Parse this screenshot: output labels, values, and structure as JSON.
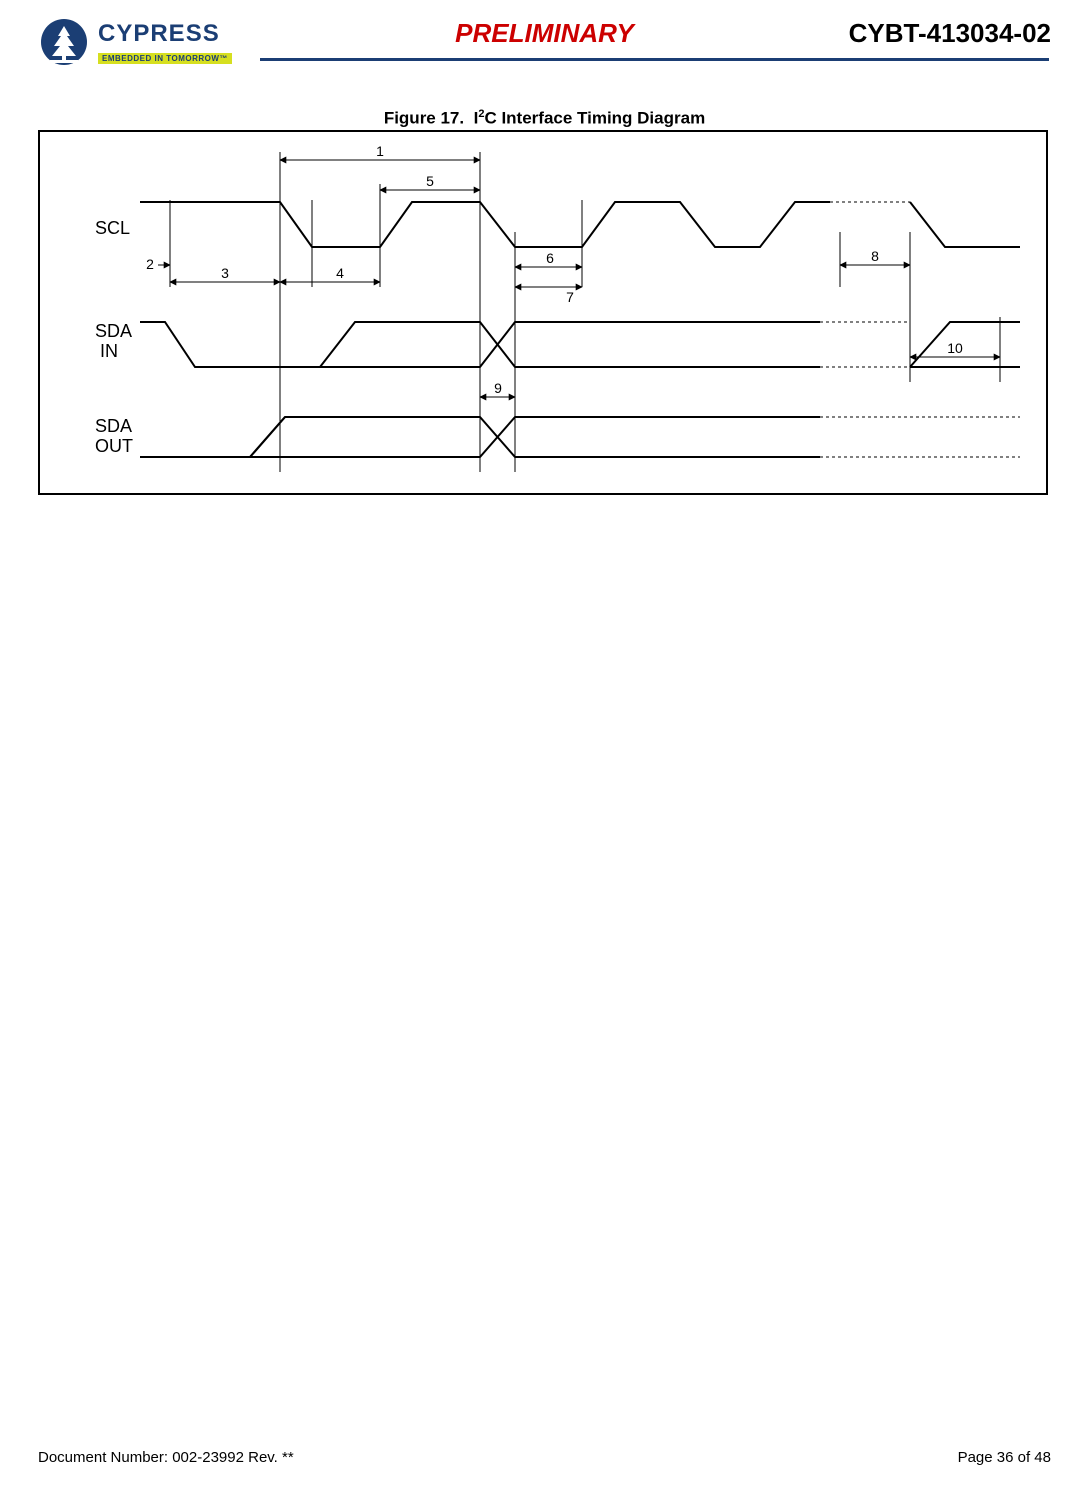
{
  "header": {
    "logo_main": "CYPRESS",
    "logo_sub": "EMBEDDED IN TOMORROW™",
    "preliminary": "PRELIMINARY",
    "part_number": "CYBT-413034-02"
  },
  "figure": {
    "number": "Figure 17.",
    "title_prefix": "I",
    "title_super": "2",
    "title_rest": "C Interface Timing Diagram",
    "signals": {
      "scl": "SCL",
      "sda_in_a": "SDA",
      "sda_in_b": "IN",
      "sda_out_a": "SDA",
      "sda_out_b": "OUT"
    },
    "markers": {
      "m1": "1",
      "m2": "2",
      "m3": "3",
      "m4": "4",
      "m5": "5",
      "m6": "6",
      "m7": "7",
      "m8": "8",
      "m9": "9",
      "m10": "10"
    }
  },
  "footer": {
    "doc_number": "Document Number: 002-23992 Rev. **",
    "page": "Page 36 of 48"
  }
}
